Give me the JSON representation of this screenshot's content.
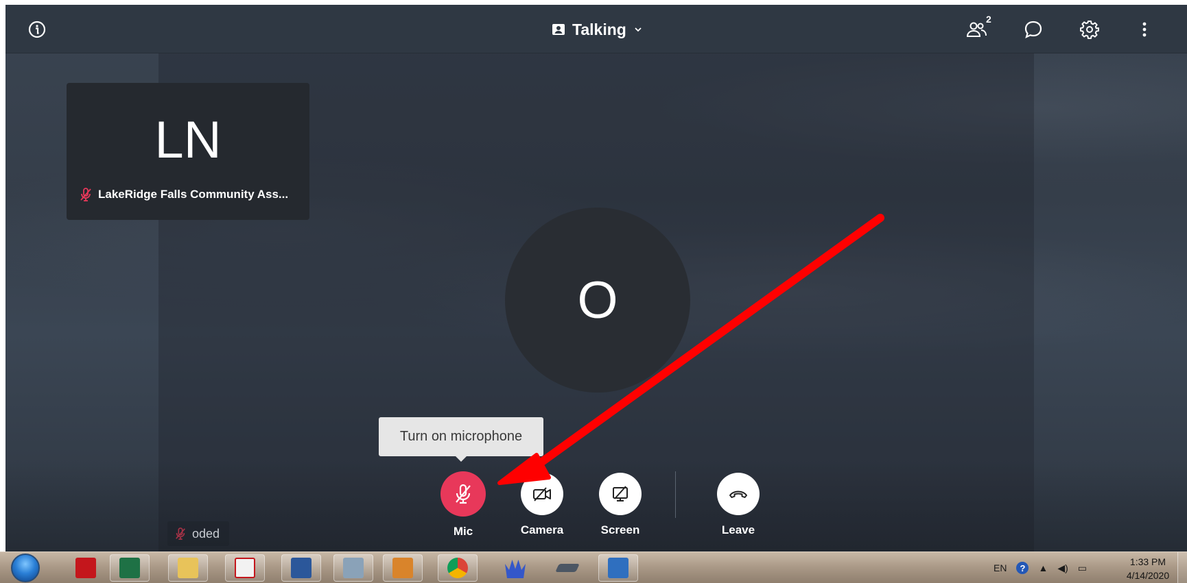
{
  "window": {
    "room_title": "Talking",
    "participants_count": "2"
  },
  "participant_tile": {
    "initials": "LN",
    "name": "LakeRidge Falls Community Ass..."
  },
  "main_avatar": {
    "initial": "O"
  },
  "tooltip": {
    "text": "Turn on microphone"
  },
  "controls": {
    "mic_label": "Mic",
    "camera_label": "Camera",
    "screen_label": "Screen",
    "leave_label": "Leave"
  },
  "self_label": {
    "text": "oded"
  },
  "colors": {
    "mic_muted_bg": "#e8385a",
    "muted_icon": "#e8385a",
    "annotation_arrow": "#ff0000",
    "topbar_bg": "#2f3843"
  },
  "taskbar": {
    "apps": [
      {
        "icon": "acrobat-reader-icon"
      },
      {
        "icon": "excel-icon"
      },
      {
        "icon": "file-explorer-icon"
      },
      {
        "icon": "acrobat-reader-icon"
      },
      {
        "icon": "word-icon"
      },
      {
        "icon": "calculator-icon"
      },
      {
        "icon": "snipping-app-icon"
      },
      {
        "icon": "chrome-icon"
      },
      {
        "icon": "crown-app-icon"
      },
      {
        "icon": "scanner-icon"
      },
      {
        "icon": "remote-desktop-icon"
      }
    ],
    "language": "EN",
    "time": "1:33 PM",
    "date": "4/14/2020"
  }
}
